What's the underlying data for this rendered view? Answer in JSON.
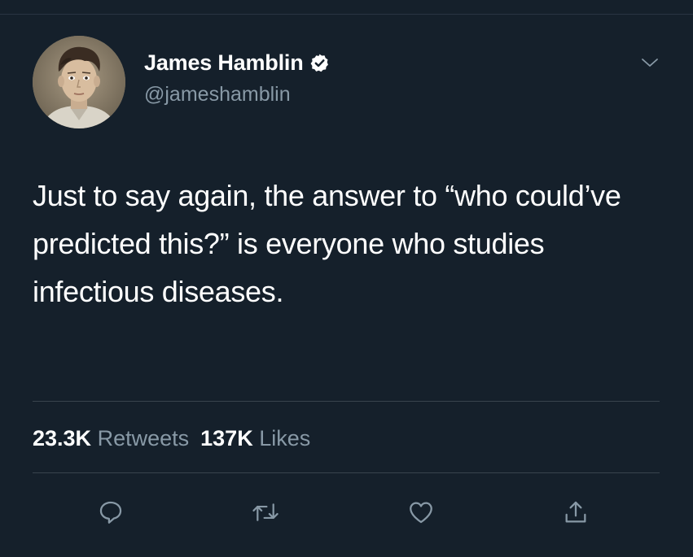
{
  "author": {
    "display_name": "James Hamblin",
    "handle": "@jameshamblin",
    "verified": true,
    "avatar_icon": "profile-photo"
  },
  "tweet": {
    "text": "Just to say again, the answer to “who could’ve predicted this?” is everyone who studies infectious diseases."
  },
  "stats": {
    "retweets_count": "23.3K",
    "retweets_label": "Retweets",
    "likes_count": "137K",
    "likes_label": "Likes"
  },
  "actions": [
    {
      "name": "reply",
      "icon": "speech-bubble-icon"
    },
    {
      "name": "retweet",
      "icon": "retweet-arrows-icon"
    },
    {
      "name": "like",
      "icon": "heart-icon"
    },
    {
      "name": "share",
      "icon": "share-upload-icon"
    }
  ],
  "colors": {
    "background": "#15202b",
    "text_primary": "#ffffff",
    "text_secondary": "#8899a6",
    "divider": "#38444d",
    "icon": "#8899a6"
  }
}
